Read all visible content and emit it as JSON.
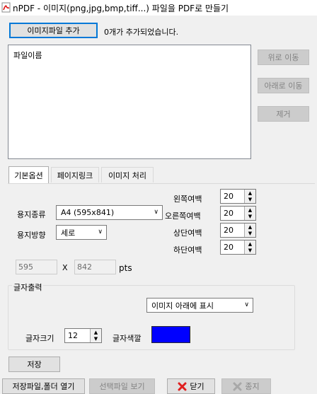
{
  "window": {
    "title": "nPDF - 이미지(png,jpg,bmp,tiff...) 파일을 PDF로 만들기"
  },
  "file_section": {
    "add_button": "이미지파일 추가",
    "status": "0개가 추가되었습니다.",
    "list_header": "파일이름",
    "move_up": "위로 이동",
    "move_down": "아래로 이동",
    "remove": "제거"
  },
  "tabs": [
    {
      "label": "기본옵션",
      "active": true
    },
    {
      "label": "페이지링크",
      "active": false
    },
    {
      "label": "이미지 처리",
      "active": false
    }
  ],
  "options": {
    "paper_type_label": "용지종류",
    "paper_type_value": "A4 (595x841)",
    "paper_orientation_label": "용지방향",
    "paper_orientation_value": "세로",
    "margins": {
      "left_label": "왼쪽여백",
      "left_value": "20",
      "right_label": "오른쪽여백",
      "right_value": "20",
      "top_label": "상단여백",
      "top_value": "20",
      "bottom_label": "하단여백",
      "bottom_value": "20"
    },
    "width_value": "595",
    "times": "X",
    "height_value": "842",
    "unit": "pts",
    "text_output": {
      "group_label": "글자출력",
      "position_value": "이미지 아래에 표시",
      "font_size_label": "글자크기",
      "font_size_value": "12",
      "font_color_label": "글자색깔",
      "font_color": "#0000ff"
    }
  },
  "buttons": {
    "save": "저장",
    "open_folder": "저장파일,폴더 열기",
    "view_selected": "선택파일 보기",
    "close": "닫기",
    "exit": "종지"
  },
  "icons": {
    "app": "pdf-app-icon",
    "close": "red-x-icon",
    "exit": "gray-x-icon"
  }
}
